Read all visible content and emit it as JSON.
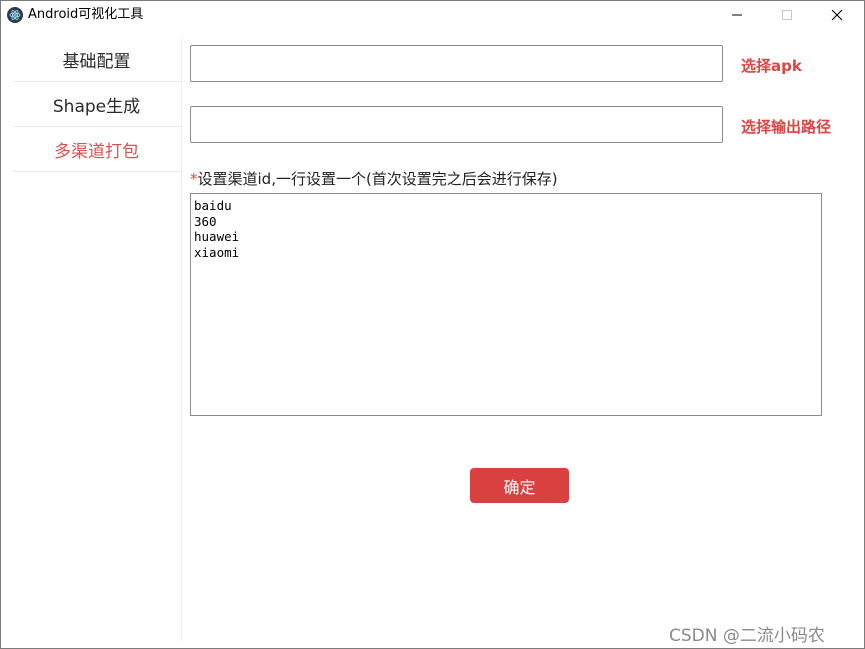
{
  "window": {
    "title": "Android可视化工具",
    "controls": [
      "minimize-icon",
      "maximize-icon",
      "close-icon"
    ]
  },
  "sidebar": {
    "items": [
      {
        "label": "基础配置",
        "active": false
      },
      {
        "label": "Shape生成",
        "active": false
      },
      {
        "label": "多渠道打包",
        "active": true
      }
    ]
  },
  "main": {
    "apk_input": {
      "value": ""
    },
    "apk_button_label": "选择apk",
    "output_input": {
      "value": ""
    },
    "output_button_label": "选择输出路径",
    "channel_label_required": "*",
    "channel_label": "设置渠道id,一行设置一个(首次设置完之后会进行保存)",
    "channels_text": "baidu\n360\nhuawei\nxiaomi",
    "confirm_label": "确定"
  },
  "watermark": "CSDN @二流小码农",
  "colors": {
    "accent": "#d94141",
    "active_nav": "#d9534f"
  }
}
